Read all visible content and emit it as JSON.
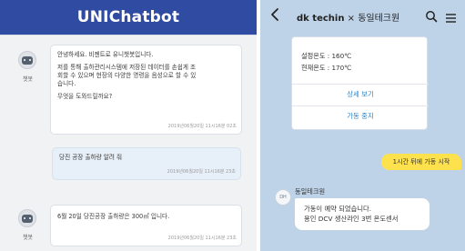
{
  "left": {
    "title": "UNIChatbot",
    "bot_name": "챗봇",
    "messages": [
      {
        "lines": [
          "안녕하세요. 비젠트로 유니챗봇입니다.",
          "",
          "저를 통해 출하관리시스템에 저장된 데이터를 손쉽게 조",
          "회할 수 있으며 현장의 다양한 명령을 음성으로 할 수 있",
          "습니다.",
          "",
          "무엇을 도와드릴까요?"
        ],
        "timestamp": "2019년06월20일 11시16분 02초"
      },
      {
        "text": "당진 공장 출하량 알려 줘",
        "timestamp": "2019년06월20일 11시16분 23초"
      },
      {
        "text": "6월 20일 당진공장 출하량은 300㎥ 입니다.",
        "timestamp": "2019년06월20일 11시16분 23초"
      }
    ]
  },
  "right": {
    "title_brand": "dk techin",
    "title_sep": " × ",
    "title_partner": "동일테크원",
    "card": {
      "set_temp": "설정온도 : 160℃",
      "current_temp": "현재온도 : 170℃",
      "detail_button": "상세 보기",
      "stop_button": "가동 중지"
    },
    "user_message": "1시간 뒤에 가동 시작",
    "sender_avatar": "DH",
    "sender_name": "동일테크원",
    "reply_line1": "가동이 예약 되었습니다.",
    "reply_line2": "용인 DCV 생산라인 3번 온도센서"
  },
  "colors": {
    "header_blue": "#304ba2",
    "right_bg": "#bfd3e8",
    "yellow_bubble": "#fde24e",
    "link_blue": "#2f86c8"
  },
  "icons": [
    "back-arrow-icon",
    "search-icon",
    "menu-icon",
    "bot-avatar-icon"
  ]
}
